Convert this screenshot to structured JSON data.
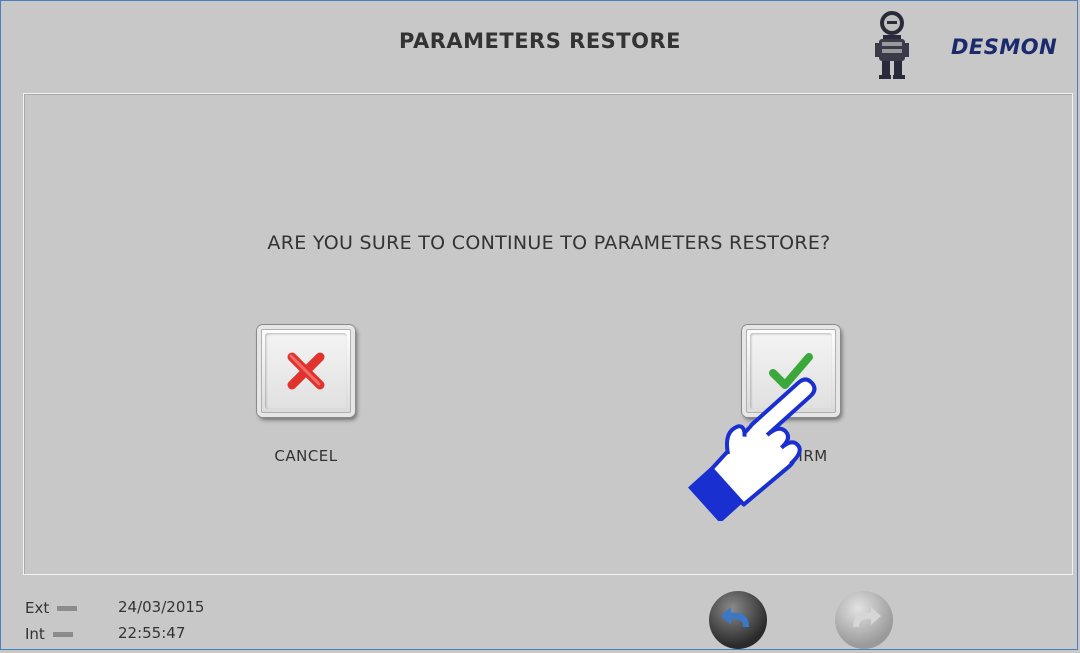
{
  "header": {
    "title": "PARAMETERS RESTORE",
    "brand": "DESMON"
  },
  "dialog": {
    "question": "ARE YOU SURE TO CONTINUE TO PARAMETERS RESTORE?",
    "cancel_label": "CANCEL",
    "confirm_label": "CONFIRM"
  },
  "footer": {
    "ext_label": "Ext",
    "int_label": "Int",
    "date": "24/03/2015",
    "time": "22:55:47"
  },
  "colors": {
    "cancel": "#e0332e",
    "confirm": "#3aa83a",
    "brand": "#1a2a6c",
    "back_button": "#3a78c8",
    "hand_outline": "#1a2fd0"
  },
  "icons": {
    "cancel": "x-icon",
    "confirm": "check-icon",
    "back": "back-arrow-icon",
    "forward": "forward-arrow-icon",
    "pointer": "pointing-hand-icon"
  }
}
